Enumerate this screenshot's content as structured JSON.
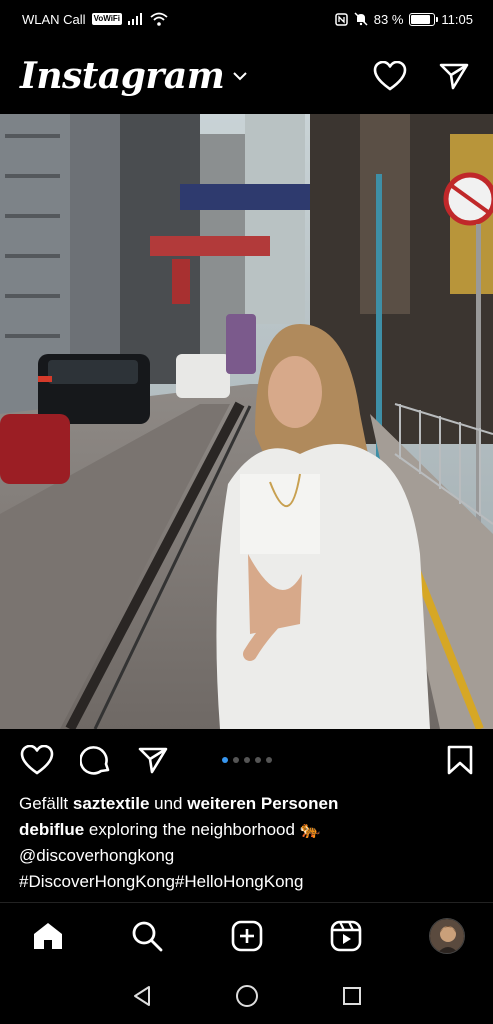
{
  "status_bar": {
    "carrier": "WLAN Call",
    "vowifi": "VoWiFi",
    "battery": "83 %",
    "battery_level": 0.83,
    "time": "11:05"
  },
  "header": {
    "logo": "Instagram",
    "icons": [
      "chevron-down-icon",
      "heart-icon",
      "send-icon"
    ]
  },
  "post": {
    "image_alt_icon": "photo",
    "carousel": {
      "count": 5,
      "active": 1
    },
    "likes_prefix": "Gefällt ",
    "likes_user": "saztextile",
    "likes_middle": " und ",
    "likes_others": "weiteren Personen",
    "caption_user": "debiflue",
    "caption_text": " exploring the neighborhood 🐅",
    "caption_mention": "@discoverhongkong",
    "caption_tags": "#DiscoverHongKong#HelloHongKong"
  },
  "colors": {
    "background": "#000000",
    "accent": "#3897f0",
    "inactive_dot": "#555555"
  },
  "bottom_nav": [
    "home-icon",
    "search-icon",
    "add-icon",
    "reels-icon",
    "profile-avatar"
  ],
  "system_nav": [
    "back-icon",
    "home-circle-icon",
    "recents-icon"
  ]
}
